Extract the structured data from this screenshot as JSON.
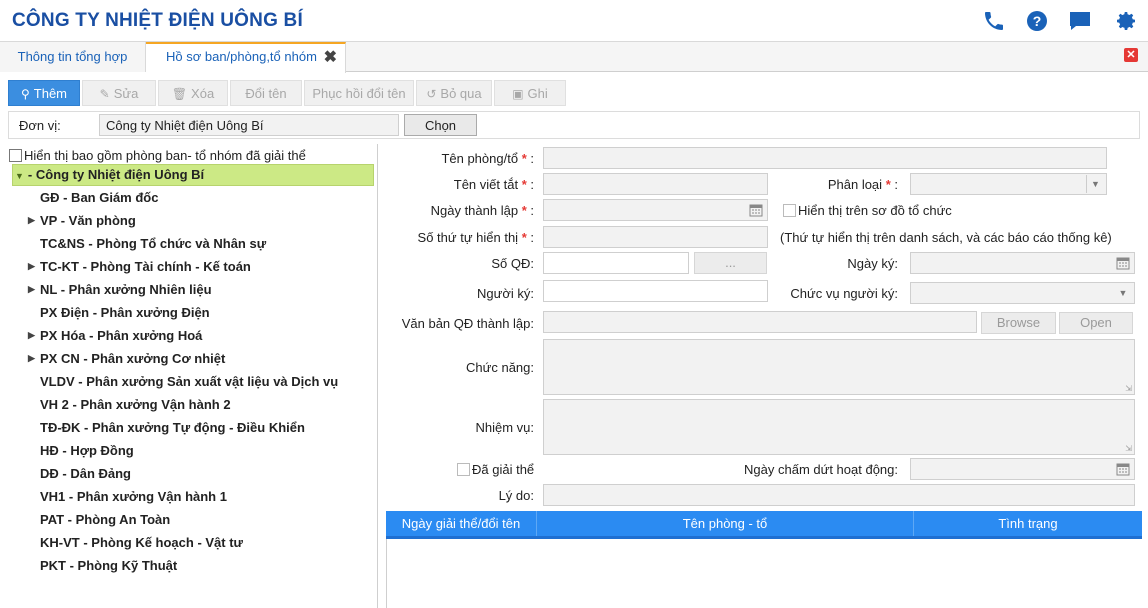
{
  "app": {
    "title": "CÔNG TY NHIỆT ĐIỆN UÔNG BÍ"
  },
  "header_icons": [
    "phone-icon",
    "help-icon",
    "chat-icon",
    "settings-icon"
  ],
  "tabs": [
    {
      "label": "Thông tin tổng hợp"
    },
    {
      "label": "Hồ sơ ban/phòng,tổ nhóm"
    }
  ],
  "tab_close": "✖",
  "window_close": "✕",
  "toolbar": {
    "add": "Thêm",
    "edit": "Sửa",
    "delete": "Xóa",
    "rename": "Đổi tên",
    "restore": "Phục hồi đổi tên",
    "skip": "Bỏ qua",
    "save": "Ghi"
  },
  "donvi": {
    "label": "Đơn vị:",
    "value": "Công ty Nhiệt điện Uông Bí",
    "button": "Chọn"
  },
  "left": {
    "include_dissolved": "Hiển thị bao gồm phòng ban- tổ nhóm đã giải thể",
    "root": "- Công ty Nhiệt điện Uông Bí",
    "items": [
      {
        "label": "GĐ - Ban Giám đốc",
        "expandable": false
      },
      {
        "label": "VP - Văn phòng",
        "expandable": true
      },
      {
        "label": "TC&NS - Phòng Tổ chức và Nhân sự",
        "expandable": false
      },
      {
        "label": "TC-KT - Phòng Tài chính - Kế toán",
        "expandable": true
      },
      {
        "label": "NL - Phân xưởng Nhiên liệu",
        "expandable": true
      },
      {
        "label": "PX Điện - Phân xưởng Điện",
        "expandable": false
      },
      {
        "label": "PX Hóa - Phân xưởng Hoá",
        "expandable": true
      },
      {
        "label": "PX CN - Phân xưởng Cơ nhiệt",
        "expandable": true
      },
      {
        "label": "VLDV - Phân xưởng Sản xuất vật liệu và Dịch vụ",
        "expandable": false
      },
      {
        "label": "VH 2 - Phân xưởng Vận hành 2",
        "expandable": false
      },
      {
        "label": "TĐ-ĐK - Phân xưởng Tự động - Điều Khiển",
        "expandable": false
      },
      {
        "label": "HĐ - Hợp Đồng",
        "expandable": false
      },
      {
        "label": "DĐ - Dân Đảng",
        "expandable": false
      },
      {
        "label": "VH1 - Phân xưởng Vận hành 1",
        "expandable": false
      },
      {
        "label": "PAT - Phòng An Toàn",
        "expandable": false
      },
      {
        "label": "KH-VT - Phòng Kế hoạch - Vật tư",
        "expandable": false
      },
      {
        "label": "PKT - Phòng Kỹ Thuật",
        "expandable": false
      }
    ]
  },
  "form": {
    "ten_phong": "Tên phòng/tổ",
    "ten_viet_tat": "Tên viết tắt",
    "phan_loai": "Phân loại",
    "ngay_thanh_lap": "Ngày thành lập",
    "hien_thi_so_do": "Hiển thị trên sơ đồ tổ chức",
    "so_thu_tu": "Số thứ tự hiển thị",
    "so_thu_tu_hint": "(Thứ tự hiển thị trên danh sách, và các báo cáo thống kê)",
    "so_qd": "Số QĐ:",
    "so_qd_btn": "...",
    "ngay_ky": "Ngày ký:",
    "nguoi_ky": "Người ký:",
    "chuc_vu_nguoi_ky": "Chức vụ người ký:",
    "van_ban_qd": "Văn bản QĐ thành lập:",
    "browse": "Browse",
    "open": "Open",
    "chuc_nang": "Chức năng:",
    "nhiem_vu": "Nhiệm vụ:",
    "da_giai_the": "Đã giải thể",
    "ngay_cham_dut": "Ngày chấm dứt hoạt động:",
    "ly_do": "Lý do:",
    "required_mark": "*",
    "colon": ":"
  },
  "grid": {
    "columns": [
      "Ngày giải thể/đổi tên",
      "Tên phòng - tổ",
      "Tình trạng"
    ]
  },
  "colors": {
    "title_blue": "#1a4fa3",
    "primary_button": "#3b8ee0",
    "tree_selected": "#cce985",
    "grid_header": "#2b8bf2",
    "required": "#e53935",
    "tab_accent": "#f5a623"
  }
}
